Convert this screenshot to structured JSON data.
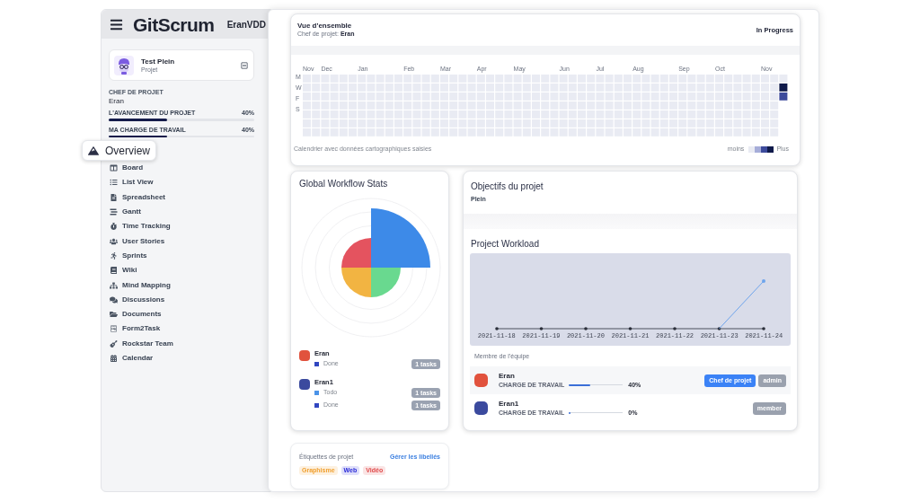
{
  "sidebar": {
    "logo": "GitScrum",
    "user": "EranVDD",
    "project": {
      "name": "Test Plein",
      "type": "Projet"
    },
    "manager": {
      "label": "CHEF DE PROJET",
      "value": "Eran"
    },
    "progress": [
      {
        "label": "L'AVANCEMENT DU PROJET",
        "reading": "40%",
        "level": 0.4
      },
      {
        "label": "MA CHARGE DE TRAVAIL",
        "reading": "40%",
        "level": 0.4
      }
    ],
    "menu": [
      {
        "label": "Overview",
        "selected": true
      },
      {
        "label": "Board",
        "selected": false
      },
      {
        "label": "List View",
        "selected": false
      },
      {
        "label": "Spreadsheet",
        "selected": false
      },
      {
        "label": "Gantt",
        "selected": false
      },
      {
        "label": "Time Tracking",
        "selected": false
      },
      {
        "label": "User Stories",
        "selected": false
      },
      {
        "label": "Sprints",
        "selected": false
      },
      {
        "label": "Wiki",
        "selected": false
      },
      {
        "label": "Mind Mapping",
        "selected": false
      },
      {
        "label": "Discussions",
        "selected": false
      },
      {
        "label": "Documents",
        "selected": false
      },
      {
        "label": "Form2Task",
        "selected": false
      },
      {
        "label": "Rockstar Team",
        "selected": false
      },
      {
        "label": "Calendar",
        "selected": false
      }
    ]
  },
  "overview": {
    "title": "Vue d'ensemble",
    "subtitle": "Chef de projet: **Eran**",
    "status": "In Progress",
    "months": [
      "Nov",
      "Dec",
      "Jan",
      "Feb",
      "Mar",
      "Apr",
      "May",
      "Jun",
      "Jul",
      "Aug",
      "Sep",
      "Oct",
      "Nov"
    ],
    "day_labels": [
      "M",
      "W",
      "F",
      "S"
    ],
    "caption": "Calendrier avec données cartographiques saisies",
    "legend_less": "moins",
    "legend_more": "Plus"
  },
  "workflow_stats": {
    "title": "Global Workflow Stats",
    "members": [
      {
        "name": "Eran",
        "color": "#e1523d",
        "statuses": [
          {
            "label": "Done",
            "color": "#3146c0",
            "count": "1 tasks"
          }
        ]
      },
      {
        "name": "Eran1",
        "color": "#3b4a9e",
        "statuses": [
          {
            "label": "Todo",
            "color": "#4b93e8",
            "count": "1 tasks"
          },
          {
            "label": "Done",
            "color": "#3146c0",
            "count": "1 tasks"
          }
        ]
      }
    ]
  },
  "project_labels": {
    "title": "Étiquettes de projet",
    "manage_link": "Gérer les libellés",
    "tags": [
      {
        "label": "Graphisme",
        "color": "#f0a030"
      },
      {
        "label": "Web",
        "color": "#2a2ad8"
      },
      {
        "label": "Vidéo",
        "color": "#e04a4a"
      }
    ]
  },
  "objectives": {
    "title": "Objectifs du projet",
    "text": "Plein"
  },
  "workload": {
    "title": "Project Workload",
    "dates": [
      "2021-11-18",
      "2021-11-19",
      "2021-11-20",
      "2021-11-21",
      "2021-11-22",
      "2021-11-23",
      "2021-11-24"
    ]
  },
  "team": {
    "title": "Membre de l'équipe",
    "members": [
      {
        "name": "Eran",
        "color": "#e1523d",
        "label": "CHARGE DE TRAVAIL",
        "level": 0.4,
        "reading": "40%",
        "roles": [
          {
            "label": "Chef de projet",
            "kind": "primary"
          },
          {
            "label": "admin",
            "kind": "muted"
          }
        ]
      },
      {
        "name": "Eran1",
        "color": "#3b4a9e",
        "label": "CHARGE DE TRAVAIL",
        "level": 0,
        "reading": "0%",
        "roles": [
          {
            "label": "member",
            "kind": "muted"
          }
        ]
      }
    ]
  }
}
